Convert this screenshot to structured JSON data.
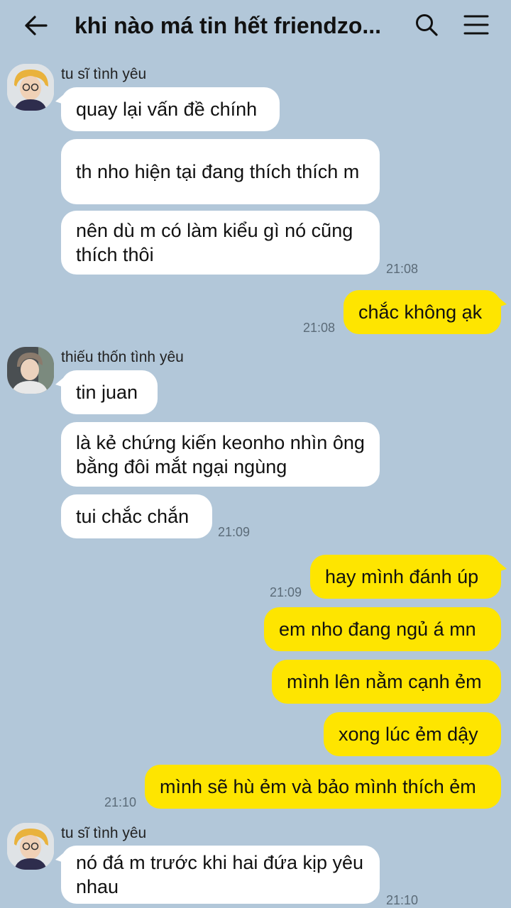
{
  "header": {
    "title": "khi nào má tin hết friendzo...",
    "back_icon": "arrow-left-icon",
    "search_icon": "search-icon",
    "menu_icon": "hamburger-menu-icon"
  },
  "colors": {
    "background": "#b2c7d9",
    "incoming_bubble": "#ffffff",
    "outgoing_bubble": "#fee500"
  },
  "messages": {
    "m1": {
      "sender": "tu sĩ tình yêu",
      "text": "quay lại vấn đề chính"
    },
    "m2": {
      "text": "th nho hiện tại đang thích thích m"
    },
    "m3": {
      "text": "nên dù m có làm kiểu gì nó cũng thích thôi",
      "time": "21:08"
    },
    "m4": {
      "text": "chắc không ạk",
      "time": "21:08"
    },
    "m5": {
      "sender": "thiếu thốn tình yêu",
      "text": "tin juan"
    },
    "m6": {
      "text": "là kẻ chứng kiến keonho nhìn ông bằng đôi mắt ngại ngùng"
    },
    "m7": {
      "text": "tui chắc chắn",
      "time": "21:09"
    },
    "m8": {
      "text": "hay mình đánh úp",
      "time": "21:09"
    },
    "m9": {
      "text": "em nho đang ngủ á mn"
    },
    "m10": {
      "text": "mình lên nằm cạnh ẻm"
    },
    "m11": {
      "text": "xong lúc ẻm dậy"
    },
    "m12": {
      "text": "mình sẽ hù ẻm và bảo mình thích ẻm",
      "time": "21:10"
    },
    "m13": {
      "sender": "tu sĩ tình yêu",
      "text": "nó đá m trước khi hai đứa kịp yêu nhau",
      "time": "21:10"
    }
  }
}
